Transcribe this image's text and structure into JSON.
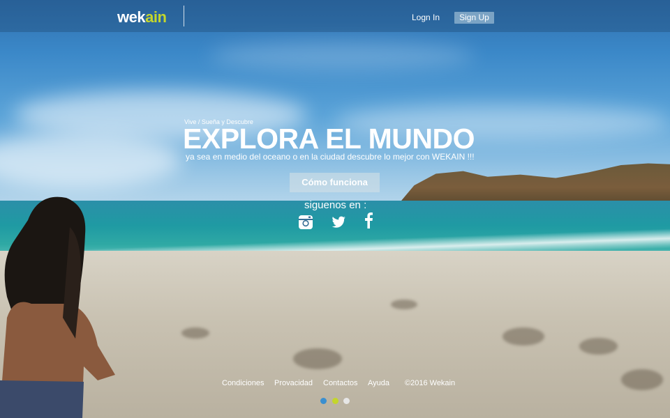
{
  "brand": {
    "logo_main": "wek",
    "logo_accent": "ain",
    "accent_color": "#c4d62c"
  },
  "nav": {
    "login": "Logn In",
    "signup": "Sign Up"
  },
  "hero": {
    "tagline": "Vive / Sueña y Descubre",
    "headline": "EXPLORA EL MUNDO",
    "subheadline": "ya sea en medio del oceano o en la ciudad descubre lo mejor con WEKAIN !!!",
    "cta": "Cómo funciona",
    "follow_label": "siguenos en :"
  },
  "social": [
    {
      "icon": "instagram-icon"
    },
    {
      "icon": "twitter-icon"
    },
    {
      "icon": "facebook-icon"
    }
  ],
  "footer": {
    "links": [
      "Condiciones",
      "Provacidad",
      "Contactos",
      "Ayuda"
    ],
    "copyright": "©2016 Wekain"
  },
  "carousel": {
    "dots": [
      {
        "color": "#3a8fd0",
        "active": true
      },
      {
        "color": "#c4d62c",
        "active": false
      },
      {
        "color": "#e6e6e6",
        "active": false
      }
    ]
  }
}
